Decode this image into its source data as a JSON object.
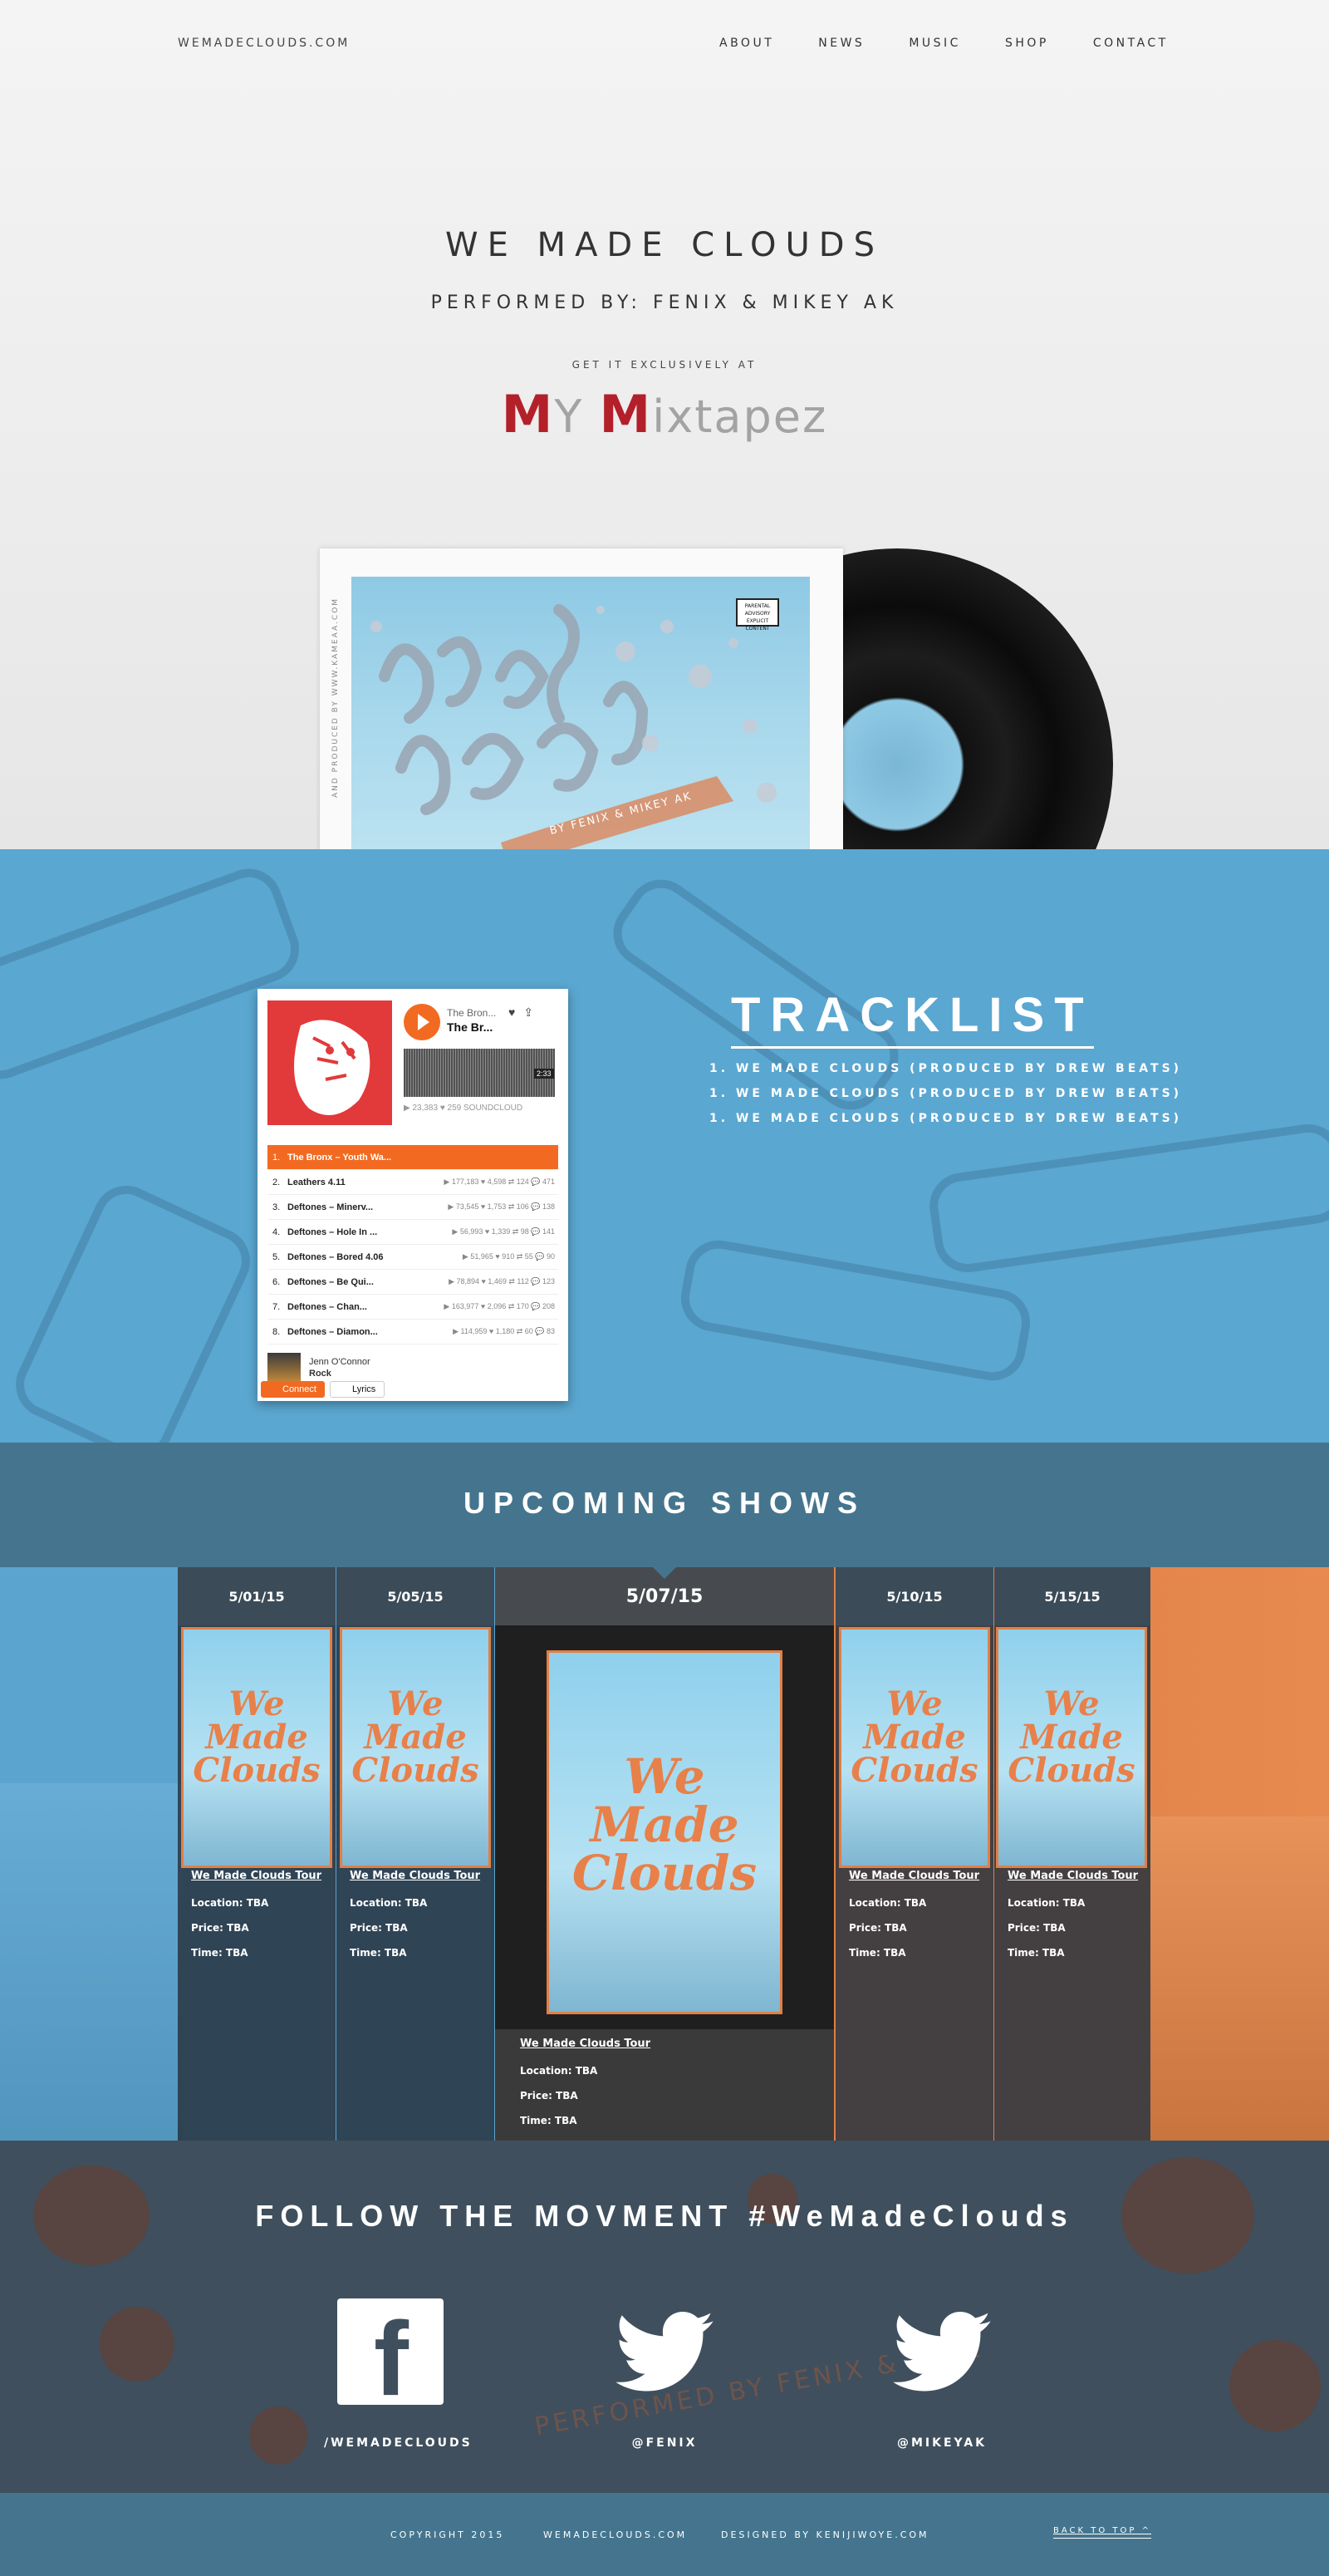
{
  "header": {
    "site": "WEMADECLOUDS.COM",
    "nav": [
      "ABOUT",
      "NEWS",
      "MUSIC",
      "SHOP",
      "CONTACT"
    ]
  },
  "hero": {
    "title": "WE MADE CLOUDS",
    "performed_by": "PERFORMED BY: FENIX & MIKEY AK",
    "get_it": "GET IT EXCLUSIVELY AT",
    "store_logo_text": "My Mixtapez",
    "album_side_text": "AND PRODUCED BY WWW.KAMEAA.COM",
    "album_credit": "BY FENIX & MIKEY AK",
    "explicit_label": "PARENTAL ADVISORY EXPLICIT CONTENT"
  },
  "player": {
    "artist": "The Bron...",
    "track": "The Br...",
    "time": "2:33",
    "stats": "▶ 23,383   ♥ 259   SOUNDCLOUD",
    "tracks": [
      {
        "num": "1.",
        "name": "The Bronx – Youth Wa...",
        "stats": ""
      },
      {
        "num": "2.",
        "name": "Leathers 4.11",
        "stats": "▶ 177,183  ♥ 4,598  ⇄ 124  💬 471"
      },
      {
        "num": "3.",
        "name": "Deftones – Minerv...",
        "stats": "▶ 73,545  ♥ 1,753  ⇄ 106  💬 138"
      },
      {
        "num": "4.",
        "name": "Deftones – Hole In ...",
        "stats": "▶ 56,993  ♥ 1,339  ⇄ 98  💬 141"
      },
      {
        "num": "5.",
        "name": "Deftones – Bored 4.06",
        "stats": "▶ 51,965  ♥ 910  ⇄ 55  💬 90"
      },
      {
        "num": "6.",
        "name": "Deftones – Be Qui...",
        "stats": "▶ 78,894  ♥ 1,469  ⇄ 112  💬 123"
      },
      {
        "num": "7.",
        "name": "Deftones – Chan...",
        "stats": "▶ 163,977  ♥ 2,096  ⇄ 170  💬 208"
      },
      {
        "num": "8.",
        "name": "Deftones – Diamon...",
        "stats": "▶ 114,959  ♥ 1,180  ⇄ 60  💬 83"
      }
    ],
    "user_name": "Jenn O'Connor",
    "user_genre": "Rock",
    "connect_label": "Connect",
    "lyrics_label": "Lyrics"
  },
  "tracklist": {
    "heading": "TRACKLIST",
    "items": [
      "1. WE MADE CLOUDS (PRODUCED BY DREW BEATS)",
      "1. WE MADE CLOUDS (PRODUCED BY DREW BEATS)",
      "1. WE MADE CLOUDS (PRODUCED BY DREW BEATS)"
    ]
  },
  "shows": {
    "heading": "UPCOMING SHOWS",
    "poster_text": "We Made Clouds",
    "items": [
      {
        "date": "5/01/15",
        "tour": "We Made Clouds Tour",
        "location": "Location: TBA",
        "price": "Price: TBA",
        "time": "Time: TBA"
      },
      {
        "date": "5/05/15",
        "tour": "We Made Clouds Tour",
        "location": "Location: TBA",
        "price": "Price: TBA",
        "time": "Time: TBA"
      },
      {
        "date": "5/07/15",
        "tour": "We Made Clouds Tour",
        "location": "Location: TBA",
        "price": "Price: TBA",
        "time": "Time: TBA"
      },
      {
        "date": "5/10/15",
        "tour": "We Made Clouds Tour",
        "location": "Location: TBA",
        "price": "Price: TBA",
        "time": "Time: TBA"
      },
      {
        "date": "5/15/15",
        "tour": "We Made Clouds Tour",
        "location": "Location: TBA",
        "price": "Price: TBA",
        "time": "Time: TBA"
      }
    ]
  },
  "follow": {
    "heading": "FOLLOW THE MOVMENT   #WeMadeClouds",
    "bg_text": "PERFORMED BY FENIX & MIKE",
    "socials": [
      {
        "icon": "facebook-icon",
        "handle": "/WEMADECLOUDS"
      },
      {
        "icon": "twitter-icon",
        "handle": "@FENIX"
      },
      {
        "icon": "twitter-icon",
        "handle": "@MIKEYAK"
      }
    ]
  },
  "footer": {
    "copyright": "COPYRIGHT 2015",
    "site": "WEMADECLOUDS.COM",
    "designed_by": "DESIGNED BY KENIJIWOYE.COM",
    "back_to_top": "BACK TO TOP ^"
  },
  "colors": {
    "accent_orange": "#f26a21",
    "sky_blue": "#5aa7d1",
    "slate": "#45758e",
    "mixtapez_red": "#b3202a"
  }
}
